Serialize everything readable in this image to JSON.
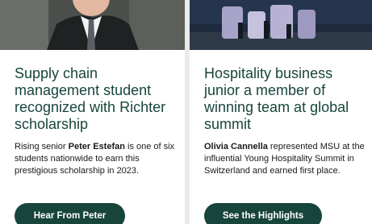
{
  "cards": [
    {
      "title": "Supply chain management student recognized with Richter scholarship",
      "body_prefix": "Rising senior ",
      "body_name": "Peter Estefan",
      "body_suffix": " is one of six students nationwide to earn this prestigious scholarship in 2023.",
      "button_label": "Hear From Peter",
      "photo_icon": "portrait-photo"
    },
    {
      "title": "Hospitality business junior a member of winning team at global summit",
      "body_prefix": "",
      "body_name": "Olivia Cannella",
      "body_suffix": " represented MSU at the influential Young Hospitality Summit in Switzerland and earned first place.",
      "button_label": "See the Highlights",
      "photo_icon": "event-stage-photo"
    }
  ],
  "colors": {
    "brand_green": "#18453b",
    "page_bg": "#e9ebea",
    "card_bg": "#ffffff",
    "body_text": "#1a1a1a"
  }
}
